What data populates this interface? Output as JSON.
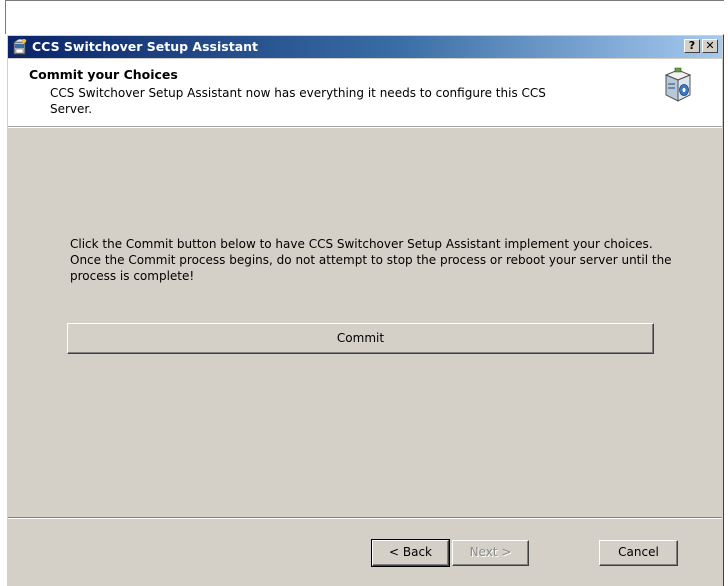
{
  "window": {
    "title": "CCS Switchover Setup Assistant",
    "help_label": "?",
    "close_label": "✕"
  },
  "header": {
    "title": "Commit your Choices",
    "description": "CCS Switchover Setup Assistant now has everything it needs to configure this CCS Server."
  },
  "main": {
    "instructions": "Click the Commit button below to have CCS Switchover Setup Assistant implement your choices. Once the Commit process begins, do not attempt to stop the process or reboot your server until the process is complete!",
    "commit_label": "Commit"
  },
  "footer": {
    "back_label": "< Back",
    "next_label": "Next >",
    "next_enabled": false,
    "cancel_label": "Cancel"
  },
  "icons": {
    "app": "setup-wizard-icon",
    "header": "setup-box-icon"
  },
  "colors": {
    "titlebar_start": "#0a246a",
    "titlebar_end": "#a6caf0",
    "dialog_face": "#d4d0c8",
    "header_bg": "#ffffff",
    "disabled_text": "#8a8a8a"
  }
}
